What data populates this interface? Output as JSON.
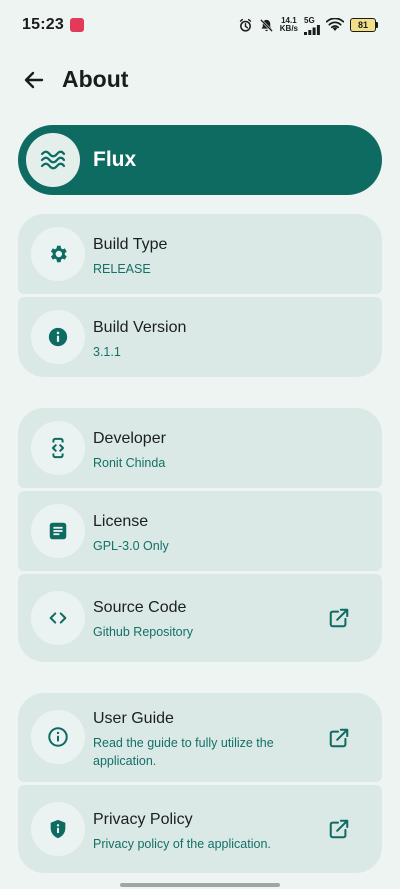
{
  "status_bar": {
    "time": "15:23",
    "net_speed_value": "14.1",
    "net_speed_unit": "KB/s",
    "network_gen": "5G",
    "battery": "81"
  },
  "app_bar": {
    "title": "About",
    "back_icon": "arrow-back-icon"
  },
  "hero": {
    "app_name": "Flux",
    "icon": "waves-icon"
  },
  "groups": [
    {
      "items": [
        {
          "title": "Build Type",
          "subtitle": "RELEASE",
          "icon": "gear-icon"
        },
        {
          "title": "Build Version",
          "subtitle": "3.1.1",
          "icon": "info-filled-icon"
        }
      ]
    },
    {
      "items": [
        {
          "title": "Developer",
          "subtitle": "Ronit Chinda",
          "icon": "developer-mode-icon"
        },
        {
          "title": "License",
          "subtitle": "GPL-3.0 Only",
          "icon": "license-doc-icon"
        },
        {
          "title": "Source Code",
          "subtitle": "Github Repository",
          "icon": "code-icon",
          "external": true
        }
      ]
    },
    {
      "items": [
        {
          "title": "User Guide",
          "subtitle": "Read the guide to fully utilize the application.",
          "icon": "info-outline-icon",
          "external": true
        },
        {
          "title": "Privacy Policy",
          "subtitle": "Privacy policy of the application.",
          "icon": "shield-icon",
          "external": true
        }
      ]
    }
  ],
  "colors": {
    "background": "#eef4f2",
    "accent": "#0e6b62",
    "card": "#dbe9e6",
    "subtitle": "#137066"
  }
}
